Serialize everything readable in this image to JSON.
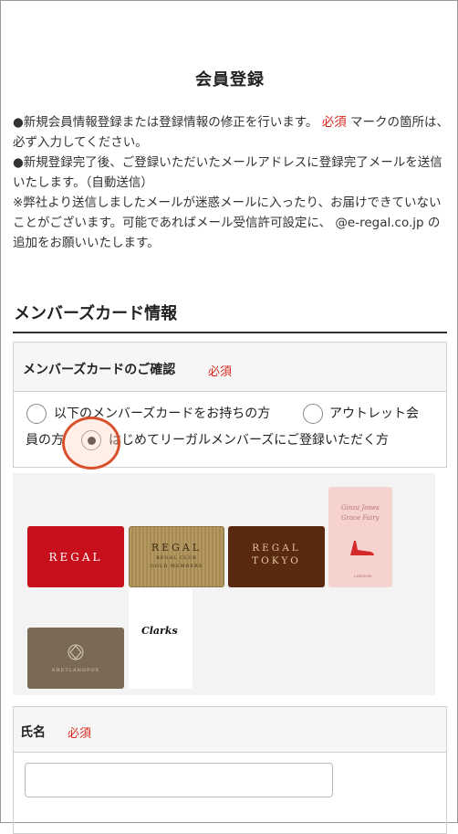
{
  "page": {
    "title": "会員登録"
  },
  "intro": {
    "line1_a": "●新規会員情報登録または登録情報の修正を行います。",
    "line1_req": "必須",
    "line1_b": "マークの箇所は、必ず入力してください。",
    "line2": "●新規登録完了後、ご登録いただいたメールアドレスに登録完了メールを送信いたします。（自動送信）",
    "line3": "※弊社より送信しましたメールが迷惑メールに入ったり、お届けできていないことがございます。可能であればメール受信許可設定に、 @e-regal.co.jp の追加をお願いいたします。"
  },
  "member_section": {
    "title": "メンバーズカード情報",
    "confirm_label": "メンバーズカードのご確認",
    "required": "必須",
    "options": [
      {
        "label": "以下のメンバーズカードをお持ちの方",
        "checked": false
      },
      {
        "label_a": "アウトレット会",
        "label_b": "員の方",
        "checked": false
      },
      {
        "label": "はじめてリーガルメンバーズにご登録いただく方",
        "checked": true
      }
    ]
  },
  "cards": {
    "regal": "REGAL",
    "gold": "REGAL",
    "gold_sub1": "REGAL CLUB",
    "gold_sub2": "GOLD MEMBERS",
    "tokyo_1": "REGAL",
    "tokyo_2": "TOKYO",
    "pink_1": "Ginza Jones",
    "pink_2": "Grace Fairy",
    "pink_small": "LONDON",
    "shirt": "SHETLANDFOX",
    "clarks": "Clarks"
  },
  "name_field": {
    "label": "氏名",
    "required": "必須",
    "value": "",
    "placeholder": ""
  },
  "colors": {
    "required_red": "#d9261c",
    "click_ring": "#d9502c"
  }
}
